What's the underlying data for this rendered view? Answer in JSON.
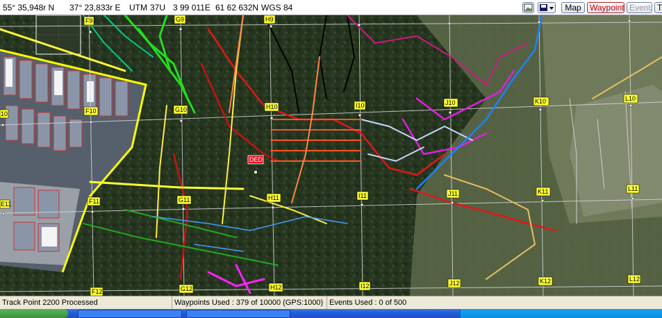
{
  "toolbar": {
    "lat": "55° 35,948r N",
    "lon": "37° 23,833r E",
    "utm_label": "UTM",
    "utm_zone": "37U",
    "easting": "3 99 011E",
    "northing": "61 62 632N",
    "datum": "WGS 84",
    "btn_map": "Map",
    "btn_waypoint": "Waypoint",
    "btn_event": "Event",
    "btn_more": "T"
  },
  "map": {
    "grid_labels": [
      {
        "id": "F9",
        "text": "F9"
      },
      {
        "id": "G9",
        "text": "G9"
      },
      {
        "id": "H9",
        "text": "H9"
      },
      {
        "id": "F10",
        "text": "F10"
      },
      {
        "id": "G10",
        "text": "G10"
      },
      {
        "id": "H10",
        "text": "H10"
      },
      {
        "id": "I10",
        "text": "I10"
      },
      {
        "id": "J10",
        "text": "J10"
      },
      {
        "id": "K10",
        "text": "K10"
      },
      {
        "id": "L10",
        "text": "L10"
      },
      {
        "id": "E10",
        "text": "10"
      },
      {
        "id": "E11",
        "text": "E11"
      },
      {
        "id": "F11",
        "text": "F11"
      },
      {
        "id": "G11",
        "text": "G11"
      },
      {
        "id": "H11",
        "text": "H11"
      },
      {
        "id": "I11",
        "text": "I11"
      },
      {
        "id": "J11",
        "text": "J11"
      },
      {
        "id": "K11",
        "text": "K11"
      },
      {
        "id": "L11",
        "text": "L11"
      },
      {
        "id": "F12",
        "text": "F12"
      },
      {
        "id": "G12",
        "text": "G12"
      },
      {
        "id": "H12",
        "text": "H12"
      },
      {
        "id": "I12",
        "text": "I12"
      },
      {
        "id": "J12",
        "text": "J12"
      },
      {
        "id": "K12",
        "text": "K12"
      },
      {
        "id": "L12",
        "text": "L12"
      }
    ],
    "waypoint_label": "DED"
  },
  "status": {
    "track": "Track Point 2200 Processed",
    "waypoints": "Waypoints Used : 379 of 10000  (GPS:1000)",
    "events": "Events Used : 0 of 500"
  },
  "colors": {
    "forest": "#26351f",
    "grid": "#d8d8d8",
    "label_bg": "#ffff33",
    "waypoint_bg": "#e01020",
    "toolbar_bg": "#ffffff"
  }
}
